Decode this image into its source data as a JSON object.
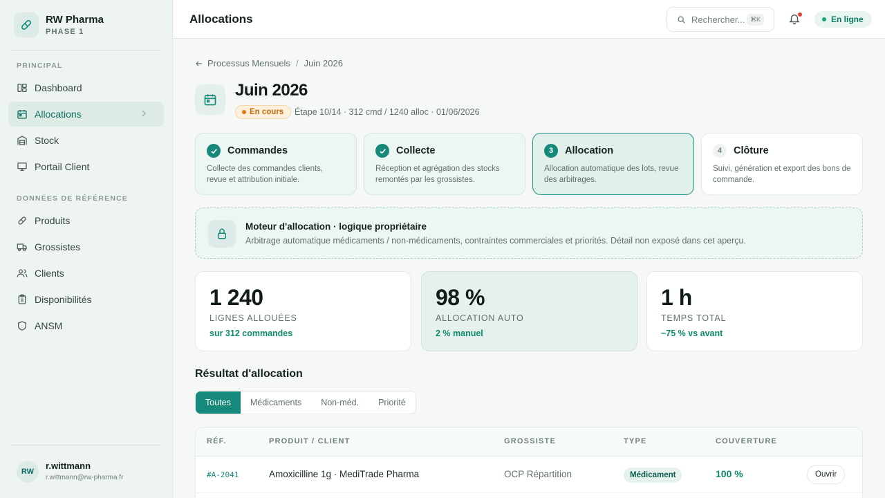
{
  "brand": {
    "name": "RW Pharma",
    "phase": "PHASE 1"
  },
  "sidebar": {
    "section_main": "PRINCIPAL",
    "main_items": [
      {
        "label": "Dashboard",
        "icon": "dashboard-icon"
      },
      {
        "label": "Allocations",
        "icon": "calendar-icon",
        "active": true
      },
      {
        "label": "Stock",
        "icon": "stock-icon"
      },
      {
        "label": "Portail Client",
        "icon": "monitor-icon"
      }
    ],
    "section_ref": "DONNÉES DE RÉFÉRENCE",
    "ref_items": [
      {
        "label": "Produits",
        "icon": "pill-icon"
      },
      {
        "label": "Grossistes",
        "icon": "truck-icon"
      },
      {
        "label": "Clients",
        "icon": "users-icon"
      },
      {
        "label": "Disponibilités",
        "icon": "clipboard-icon"
      },
      {
        "label": "ANSM",
        "icon": "shield-icon"
      }
    ]
  },
  "user": {
    "initials": "RW",
    "name": "r.wittmann",
    "email": "r.wittmann@rw-pharma.fr"
  },
  "topbar": {
    "title": "Allocations",
    "search_placeholder": "Rechercher...",
    "search_shortcut": "⌘K",
    "status": "En ligne"
  },
  "breadcrumb": {
    "parent": "Processus Mensuels",
    "separator": "/",
    "current": "Juin 2026"
  },
  "header": {
    "title": "Juin 2026",
    "badge": "En cours",
    "meta": "Étape 10/14 · 312 cmd / 1240 alloc · 01/06/2026"
  },
  "steps": [
    {
      "num": "1",
      "title": "Commandes",
      "desc": "Collecte des commandes clients, revue et attribution initiale.",
      "state": "done"
    },
    {
      "num": "2",
      "title": "Collecte",
      "desc": "Réception et agrégation des stocks remontés par les grossistes.",
      "state": "done"
    },
    {
      "num": "3",
      "title": "Allocation",
      "desc": "Allocation automatique des lots, revue des arbitrages.",
      "state": "current"
    },
    {
      "num": "4",
      "title": "Clôture",
      "desc": "Suivi, génération et export des bons de commande.",
      "state": "pending"
    }
  ],
  "engine": {
    "title": "Moteur d'allocation · logique propriétaire",
    "desc": "Arbitrage automatique médicaments / non-médicaments, contraintes commerciales et priorités. Détail non exposé dans cet aperçu."
  },
  "kpis": [
    {
      "value": "1 240",
      "label": "LIGNES ALLOUÉES",
      "sub": "sur 312 commandes"
    },
    {
      "value": "98 %",
      "label": "ALLOCATION AUTO",
      "sub": "2 % manuel"
    },
    {
      "value": "1 h",
      "label": "TEMPS TOTAL",
      "sub": "−75 % vs avant"
    }
  ],
  "results": {
    "title": "Résultat d'allocation",
    "tabs": [
      "Toutes",
      "Médicaments",
      "Non-méd.",
      "Priorité"
    ],
    "columns": [
      "RÉF.",
      "PRODUIT / CLIENT",
      "GROSSISTE",
      "TYPE",
      "COUVERTURE"
    ],
    "rows": [
      {
        "ref": "#A-2041",
        "product": "Amoxicilline 1g · MediTrade Pharma",
        "wholesaler": "OCP Répartition",
        "type": "Médicament",
        "coverage": "100 %",
        "action": "Ouvrir"
      }
    ]
  },
  "colors": {
    "accent": "#16897a",
    "success": "#0e8a6a",
    "warning": "#e07d0a"
  }
}
